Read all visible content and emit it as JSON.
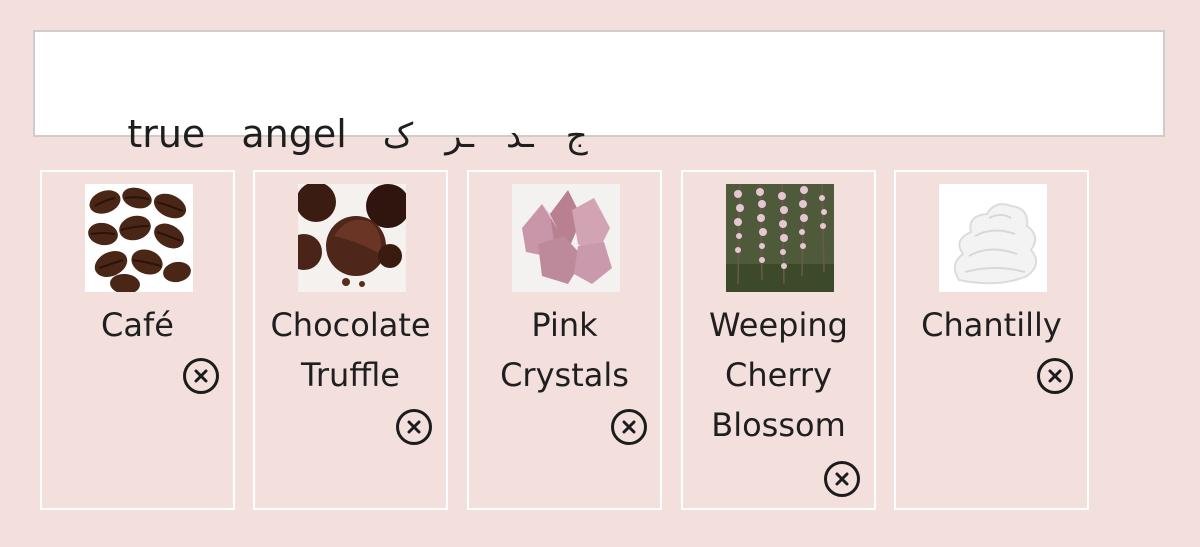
{
  "search": {
    "word1": "true",
    "word2": "angel",
    "glyph1": "ک",
    "glyph2": "ـر",
    "glyph3": "ـد",
    "glyph4": "ج"
  },
  "cards": [
    {
      "label_line1": "Café",
      "label_line2": "",
      "label_line3": "",
      "thumb": "coffee-beans-image"
    },
    {
      "label_line1": "Chocolate",
      "label_line2": "Truffle",
      "label_line3": "",
      "thumb": "chocolate-truffle-image"
    },
    {
      "label_line1": "Pink",
      "label_line2": "Crystals",
      "label_line3": "",
      "thumb": "pink-crystals-image"
    },
    {
      "label_line1": "Weeping",
      "label_line2": "Cherry",
      "label_line3": "Blossom",
      "thumb": "cherry-blossom-image"
    },
    {
      "label_line1": "Chantilly",
      "label_line2": "",
      "label_line3": "",
      "thumb": "whipped-cream-image"
    }
  ],
  "remove_icon": "close-circle-icon",
  "colors": {
    "background": "#f3e0dc",
    "search_bg": "#ffffff",
    "card_border": "#ffffff",
    "text": "#1f1f1f"
  }
}
